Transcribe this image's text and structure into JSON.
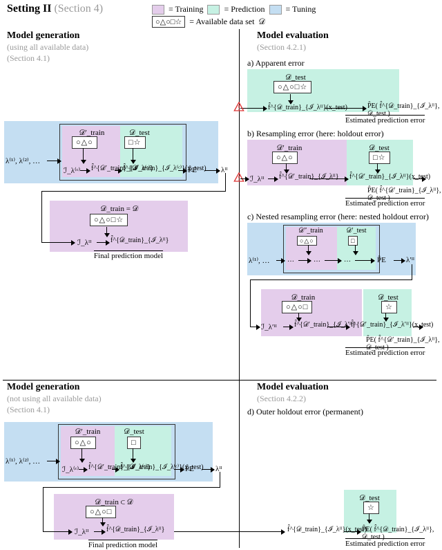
{
  "setting": {
    "title": "Setting II",
    "section": "(Section 4)"
  },
  "legend": {
    "train": "= Training",
    "pred": "= Prediction",
    "tune": "= Tuning",
    "avail_pre": "= Available data set",
    "shapes": "○△○□☆",
    "D": "𝒟"
  },
  "mg_top": {
    "title": "Model generation",
    "line1": "(using all available data)",
    "line2": "(Section 4.1)"
  },
  "mg_bottom": {
    "title": "Model generation",
    "line1": "(not using all available data)",
    "line2": "(Section 4.1)"
  },
  "me_top": {
    "title": "Model evaluation",
    "line": "(Section 4.2.1)"
  },
  "me_bot": {
    "title": "Model evaluation",
    "line": "(Section 4.2.2)"
  },
  "labels": {
    "a": "a) Apparent error",
    "b": "b) Resampling error (here: holdout error)",
    "c": "c) Nested resampling error (here: nested holdout error)",
    "d": "d) Outer holdout error (permanent)",
    "Dtest": "𝒟_test",
    "Dtest_p": "𝒟′_test",
    "Dtrain": "𝒟_train",
    "Dtrain_p": "𝒟′_train",
    "Dtrain_pp": "𝒟″_train",
    "Dtrain_eq_D": "𝒟_train = 𝒟",
    "Dtrain_sub_D": "𝒟_train ⊂ 𝒟",
    "shapes5": "○△○□☆",
    "shapes3": "○△○",
    "shapes2_sq_st": "□☆",
    "shapes2_sq": "□",
    "shapes4": "○△○□",
    "star": "☆",
    "lambdas": "λ⁽¹⁾, λ⁽²⁾, …",
    "lambdas_short": "λ⁽¹⁾, …",
    "I_lc": "ℐ_λ⁽ᶜ⁾",
    "I_lII": "ℐ_λᴵᴵ",
    "fhat_train_p": "f̂^{𝒟′_train}_{ℐ_λ⁽ᶜ⁾}",
    "fhat_train_p_x": "f̂^{𝒟′_train}_{ℐ_λ⁽ᶜ⁾}(x_test)",
    "fhat_DtrainII": "f̂^{𝒟_train}_{ℐ_λᴵᴵ}",
    "fhat_Dtrain_p_II": "f̂^{𝒟′_train}_{ℐ_λᴵᴵ}",
    "fhat_Dtrain_p_II_x": "f̂^{𝒟′_train}_{ℐ_λᴵᴵ}(x_test)",
    "fhat_DtrainII_x": "f̂^{𝒟_train}_{ℐ_λᴵᴵ}(x_test)",
    "PEhat": "P̂E",
    "PEhat_full": "P̂E( f̂^{𝒟_train}_{ℐ_λᴵᴵ}, 𝒟_test )",
    "PEhat_full_p": "P̂E( f̂^{𝒟′_train}_{ℐ_λᴵᴵ}, 𝒟_test )",
    "lambdaII": "λᴵᴵ",
    "lambda_pII": "λ′ᴵᴵ",
    "est": "Estimated prediction error",
    "final": "Final prediction model",
    "dots": "…"
  }
}
